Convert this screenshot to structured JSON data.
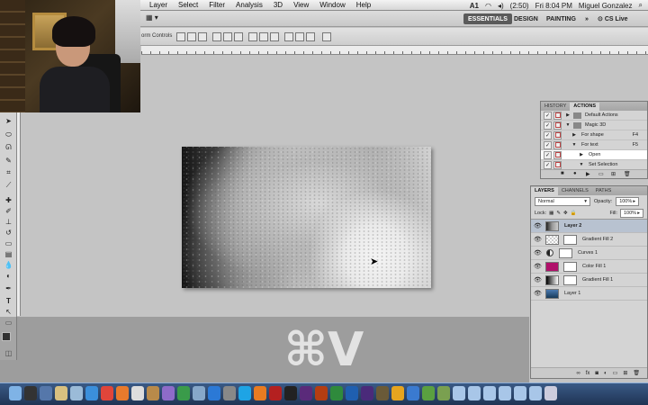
{
  "menubar": {
    "items": [
      "Layer",
      "Select",
      "Filter",
      "Analysis",
      "3D",
      "View",
      "Window",
      "Help"
    ],
    "status": {
      "adobe_badge": "A1",
      "battery": "(2:50)",
      "clock": "Fri 8:04 PM",
      "user": "Miguel Gonzalez"
    }
  },
  "appbar": {
    "workspaces": [
      "ESSENTIALS",
      "DESIGN",
      "PAINTING"
    ],
    "more": "»",
    "cslive": "CS Live"
  },
  "options": {
    "transform_label": "orm Controls"
  },
  "actions_panel": {
    "tabs": [
      "HISTORY",
      "ACTIONS"
    ],
    "rows": [
      {
        "label": "Default Actions",
        "key": "",
        "kind": "set"
      },
      {
        "label": "Magic 3D",
        "key": "",
        "kind": "set"
      },
      {
        "label": "For shape",
        "key": "F4",
        "kind": "action"
      },
      {
        "label": "For text",
        "key": "F5",
        "kind": "action"
      },
      {
        "label": "Open",
        "key": "",
        "kind": "step"
      },
      {
        "label": "Set Selection",
        "key": "",
        "kind": "step"
      }
    ]
  },
  "layers_panel": {
    "tabs": [
      "LAYERS",
      "CHANNELS",
      "PATHS"
    ],
    "blend_mode": "Normal",
    "opacity_label": "Opacity:",
    "opacity_value": "100%",
    "lock_label": "Lock:",
    "fill_label": "Fill:",
    "fill_value": "100%",
    "layers": [
      {
        "name": "Layer 2",
        "type": "pixel",
        "thumb": "texture",
        "selected": true
      },
      {
        "name": "Gradient Fill 2",
        "type": "fill",
        "thumb": "checker",
        "selected": false
      },
      {
        "name": "Curves 1",
        "type": "adjustment",
        "thumb": "adj",
        "selected": false
      },
      {
        "name": "Color Fill 1",
        "type": "fill",
        "thumb": "#b0106a",
        "selected": false
      },
      {
        "name": "Gradient Fill 1",
        "type": "fill",
        "thumb": "gradient",
        "selected": false
      },
      {
        "name": "Layer 1",
        "type": "pixel",
        "thumb": "photo",
        "selected": false
      }
    ]
  },
  "overlay": {
    "shortcut": "⌘V"
  },
  "dock": {
    "icons": [
      "finder-icon",
      "dashboard-icon",
      "mission-control-icon",
      "photos-icon",
      "mail-icon",
      "safari-icon",
      "chrome-icon",
      "firefox-icon",
      "ical-icon",
      "address-book-icon",
      "itunes-icon",
      "facetime-icon",
      "preview-icon",
      "app-store-icon",
      "system-prefs-icon",
      "skype-icon",
      "vlc-icon",
      "filezilla-icon",
      "terminal-icon",
      "premiere-icon",
      "fireworks-icon",
      "dreamweaver-icon",
      "photoshop-icon",
      "after-effects-icon",
      "bridge-icon",
      "illustrator-icon",
      "xcode-icon",
      "minecraft-icon",
      "coda-icon",
      "folder-icon",
      "folder-icon",
      "folder-icon",
      "folder-icon",
      "folder-icon",
      "folder-icon",
      "trash-icon"
    ],
    "colors": [
      "#7fb3e6",
      "#333",
      "#5577aa",
      "#d8c080",
      "#9bbbd8",
      "#3b8fdb",
      "#e0453a",
      "#e87a2c",
      "#ddd",
      "#b88a4a",
      "#8e6bc9",
      "#3a9b4a",
      "#86a7c9",
      "#2b79d6",
      "#888",
      "#1ea4e5",
      "#e87b21",
      "#b42020",
      "#222",
      "#5a2a7a",
      "#b43d12",
      "#2f8a3c",
      "#1f5fb0",
      "#4a2a7a",
      "#6a5a38",
      "#e6a41f",
      "#3a7ad0",
      "#5aa040",
      "#7aa050",
      "#a8c6e8",
      "#a8c6e8",
      "#a8c6e8",
      "#a8c6e8",
      "#a8c6e8",
      "#a8c6e8",
      "#ccd"
    ]
  }
}
